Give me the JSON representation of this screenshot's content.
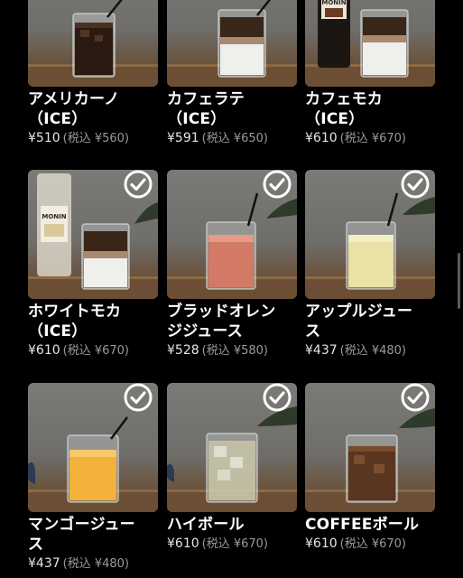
{
  "menu": {
    "items": [
      {
        "name": "アメリカーノ\n（ICE）",
        "price": "¥510",
        "tax_note": "(税込 ¥560)",
        "selected": false
      },
      {
        "name": "カフェラテ\n（ICE）",
        "price": "¥591",
        "tax_note": "(税込 ¥650)",
        "selected": false
      },
      {
        "name": "カフェモカ\n（ICE）",
        "price": "¥610",
        "tax_note": "(税込 ¥670)",
        "selected": false
      },
      {
        "name": "ホワイトモカ\n（ICE）",
        "price": "¥610",
        "tax_note": "(税込 ¥670)",
        "selected": true
      },
      {
        "name": "ブラッドオレン\nジジュース",
        "price": "¥528",
        "tax_note": "(税込 ¥580)",
        "selected": true
      },
      {
        "name": "アップルジュー\nス",
        "price": "¥437",
        "tax_note": "(税込 ¥480)",
        "selected": true
      },
      {
        "name": "マンゴージュー\nス",
        "price": "¥437",
        "tax_note": "(税込 ¥480)",
        "selected": true
      },
      {
        "name": "ハイボール",
        "price": "¥610",
        "tax_note": "(税込 ¥670)",
        "selected": true
      },
      {
        "name": "COFFEEボール",
        "price": "¥610",
        "tax_note": "(税込 ¥670)",
        "selected": true
      }
    ],
    "bottle_label": "MONIN",
    "icons": {
      "check": "check-circle-icon"
    },
    "colors": {
      "background": "#000000",
      "check": "#ffffff",
      "price_tax": "#9a9a9a"
    }
  }
}
